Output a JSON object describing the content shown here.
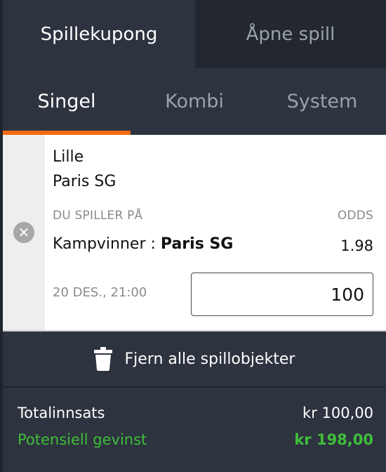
{
  "tabs": {
    "betslip": "Spillekupong",
    "open_bets": "Åpne spill"
  },
  "bet_types": {
    "single": "Singel",
    "combo": "Kombi",
    "system": "System"
  },
  "bet": {
    "home_team": "Lille",
    "away_team": "Paris SG",
    "selection_header": "DU SPILLER PÅ",
    "odds_header": "ODDS",
    "market": "Kampvinner :",
    "selection": "Paris SG",
    "odds": "1.98",
    "date": "20 DES., 21:00",
    "stake": "100"
  },
  "actions": {
    "remove_all": "Fjern alle spillobjekter"
  },
  "totals": {
    "stake_label": "Totalinnsats",
    "stake_value": "kr 100,00",
    "win_label": "Potensiell gevinst",
    "win_value": "kr 198,00"
  },
  "icons": {
    "remove": "close-circle-icon",
    "remove_all": "trash-icon"
  },
  "colors": {
    "accent": "#f26a13",
    "win": "#3fbe3a",
    "panel": "#2d333f"
  }
}
